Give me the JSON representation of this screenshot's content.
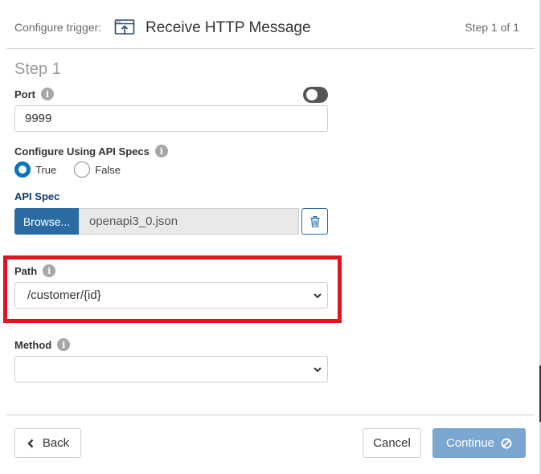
{
  "header": {
    "configure_label": "Configure trigger:",
    "title": "Receive HTTP Message",
    "step_indicator": "Step 1 of 1",
    "trigger_icon": "http-message-icon"
  },
  "step": {
    "heading": "Step 1"
  },
  "port": {
    "label": "Port",
    "value": "9999",
    "toggle_state": "on"
  },
  "api_specs": {
    "label": "Configure Using API Specs",
    "options": [
      {
        "label": "True",
        "checked": true
      },
      {
        "label": "False",
        "checked": false
      }
    ]
  },
  "api_spec": {
    "label": "API Spec",
    "browse_label": "Browse...",
    "file_name": "openapi3_0.json",
    "delete_icon": "trash-icon"
  },
  "path": {
    "label": "Path",
    "selected": "/customer/{id}",
    "highlight_color": "#e0141e"
  },
  "method": {
    "label": "Method",
    "selected": ""
  },
  "footer": {
    "back_label": "Back",
    "cancel_label": "Cancel",
    "continue_label": "Continue"
  },
  "colors": {
    "accent": "#2a6ba4",
    "radio_selected": "#0b74be",
    "continue_disabled": "#7ba6cf"
  }
}
